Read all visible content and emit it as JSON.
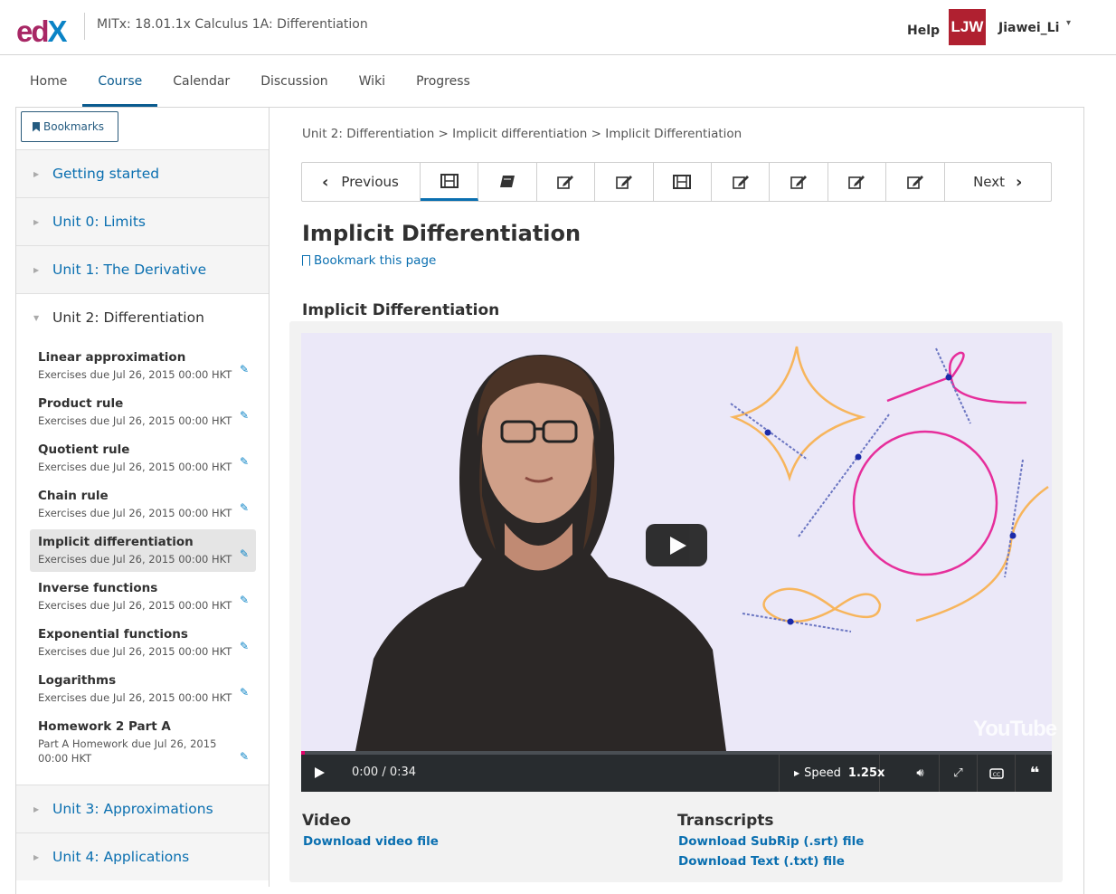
{
  "header": {
    "logo": {
      "e": "e",
      "d": "d",
      "x": "X"
    },
    "course_title": "MITx: 18.01.1x Calculus 1A: Differentiation",
    "help": "Help",
    "avatar_initials": "LJW",
    "username": "Jiawei_Li",
    "caret": "▾"
  },
  "tabs": [
    "Home",
    "Course",
    "Calendar",
    "Discussion",
    "Wiki",
    "Progress"
  ],
  "active_tab": "Course",
  "sidebar": {
    "bookmarks_label": "Bookmarks",
    "chapters": [
      {
        "label": "Getting started"
      },
      {
        "label": "Unit 0: Limits"
      },
      {
        "label": "Unit 1: The Derivative"
      },
      {
        "label": "Unit 2: Differentiation"
      },
      {
        "label": "Unit 3: Approximations"
      },
      {
        "label": "Unit 4: Applications"
      }
    ],
    "sections": [
      {
        "title": "Linear approximation",
        "due": "Exercises due Jul 26, 2015 00:00 HKT"
      },
      {
        "title": "Product rule",
        "due": "Exercises due Jul 26, 2015 00:00 HKT"
      },
      {
        "title": "Quotient rule",
        "due": "Exercises due Jul 26, 2015 00:00 HKT"
      },
      {
        "title": "Chain rule",
        "due": "Exercises due Jul 26, 2015 00:00 HKT"
      },
      {
        "title": "Implicit differentiation",
        "due": "Exercises due Jul 26, 2015 00:00 HKT"
      },
      {
        "title": "Inverse functions",
        "due": "Exercises due Jul 26, 2015 00:00 HKT"
      },
      {
        "title": "Exponential functions",
        "due": "Exercises due Jul 26, 2015 00:00 HKT"
      },
      {
        "title": "Logarithms",
        "due": "Exercises due Jul 26, 2015 00:00 HKT"
      },
      {
        "title": "Homework 2 Part A",
        "due": "Part A Homework due Jul 26, 2015 00:00 HKT"
      }
    ]
  },
  "main": {
    "breadcrumb": "Unit 2: Differentiation > Implicit differentiation > Implicit Differentiation",
    "seq_prev": "Previous",
    "seq_next": "Next",
    "seq_items": [
      "video-icon",
      "book-icon",
      "edit-icon",
      "edit-icon",
      "video-icon",
      "edit-icon",
      "edit-icon",
      "edit-icon",
      "edit-icon"
    ],
    "page_title": "Implicit Differentiation",
    "bookmark_link": "Bookmark this page",
    "video_heading": "Implicit Differentiation",
    "video": {
      "time": "0:00 / 0:34",
      "speed_label": "Speed",
      "speed_value": "1.25x",
      "yt_mark": "YouTube",
      "progress": 0.005
    },
    "downloads": {
      "video_heading": "Video",
      "video_link": "Download video file",
      "transcripts_heading": "Transcripts",
      "srt_link": "Download SubRip (.srt) file",
      "txt_link": "Download Text (.txt) file"
    }
  },
  "colors": {
    "brand_blue": "#0a6fb0",
    "edx_pink": "#a82765",
    "progress": "#e3006b"
  }
}
